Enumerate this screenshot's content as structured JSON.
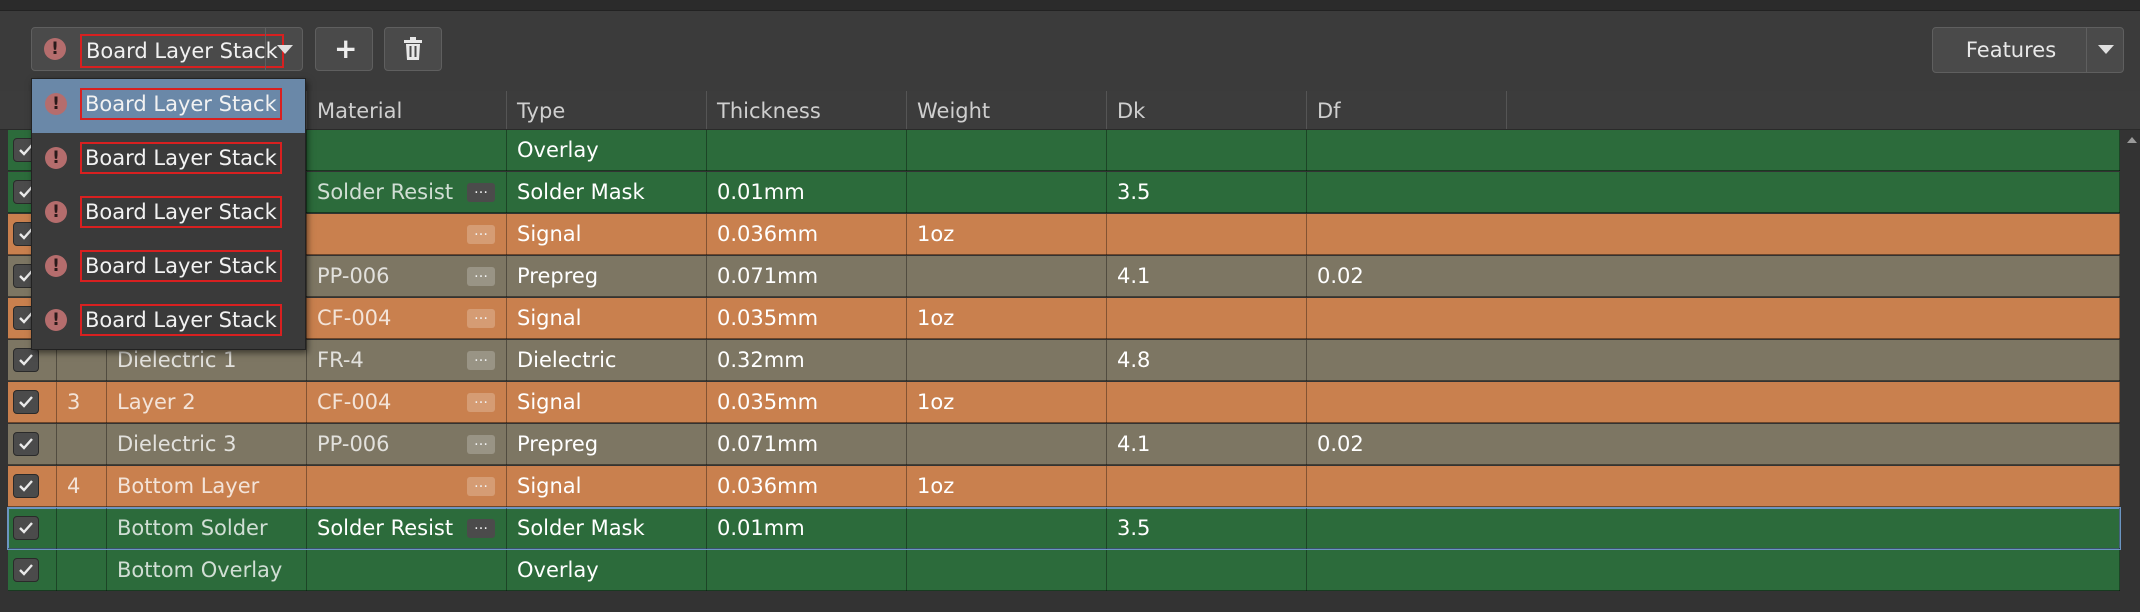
{
  "toolbar": {
    "stack_name": "Board Layer Stack",
    "add_label": "+",
    "features_label": "Features"
  },
  "dropdown": {
    "items": [
      {
        "label": "Board Layer Stack",
        "highlighted": true
      },
      {
        "label": "Board Layer Stack",
        "highlighted": false
      },
      {
        "label": "Board Layer Stack",
        "highlighted": false
      },
      {
        "label": "Board Layer Stack",
        "highlighted": false
      },
      {
        "label": "Board Layer Stack",
        "highlighted": false
      }
    ]
  },
  "table": {
    "headers": {
      "material": "Material",
      "type": "Type",
      "thickness": "Thickness",
      "weight": "Weight",
      "dk": "Dk",
      "df": "Df"
    },
    "rows": [
      {
        "num": "",
        "name": "",
        "material": "",
        "has_more": false,
        "type": "Overlay",
        "thickness": "",
        "weight": "",
        "dk": "",
        "df": "",
        "kind": "overlay"
      },
      {
        "num": "",
        "name": "",
        "material": "Solder Resist",
        "has_more": true,
        "type": "Solder Mask",
        "thickness": "0.01mm",
        "weight": "",
        "dk": "3.5",
        "df": "",
        "kind": "mask"
      },
      {
        "num": "",
        "name": "",
        "material": "",
        "has_more": true,
        "type": "Signal",
        "thickness": "0.036mm",
        "weight": "1oz",
        "dk": "",
        "df": "",
        "kind": "signal"
      },
      {
        "num": "",
        "name": "",
        "material": "PP-006",
        "has_more": true,
        "type": "Prepreg",
        "thickness": "0.071mm",
        "weight": "",
        "dk": "4.1",
        "df": "0.02",
        "kind": "dielectric"
      },
      {
        "num": "",
        "name": "",
        "material": "CF-004",
        "has_more": true,
        "type": "Signal",
        "thickness": "0.035mm",
        "weight": "1oz",
        "dk": "",
        "df": "",
        "kind": "signal"
      },
      {
        "num": "",
        "name": "Dielectric 1",
        "material": "FR-4",
        "has_more": true,
        "type": "Dielectric",
        "thickness": "0.32mm",
        "weight": "",
        "dk": "4.8",
        "df": "",
        "kind": "dielectric"
      },
      {
        "num": "3",
        "name": "Layer 2",
        "material": "CF-004",
        "has_more": true,
        "type": "Signal",
        "thickness": "0.035mm",
        "weight": "1oz",
        "dk": "",
        "df": "",
        "kind": "signal"
      },
      {
        "num": "",
        "name": "Dielectric 3",
        "material": "PP-006",
        "has_more": true,
        "type": "Prepreg",
        "thickness": "0.071mm",
        "weight": "",
        "dk": "4.1",
        "df": "0.02",
        "kind": "dielectric"
      },
      {
        "num": "4",
        "name": "Bottom Layer",
        "material": "",
        "has_more": true,
        "type": "Signal",
        "thickness": "0.036mm",
        "weight": "1oz",
        "dk": "",
        "df": "",
        "kind": "signal"
      },
      {
        "num": "",
        "name": "Bottom Solder",
        "material": "Solder Resist",
        "has_more": true,
        "type": "Solder Mask",
        "thickness": "0.01mm",
        "weight": "",
        "dk": "3.5",
        "df": "",
        "kind": "mask",
        "selected": true
      },
      {
        "num": "",
        "name": "Bottom Overlay",
        "material": "",
        "has_more": false,
        "type": "Overlay",
        "thickness": "",
        "weight": "",
        "dk": "",
        "df": "",
        "kind": "overlay"
      }
    ]
  },
  "colors": {
    "overlay": "#2c6b3b",
    "mask": "#2c6b3b",
    "signal": "#c9804e",
    "dielectric": "#7d7663",
    "selected_border": "#6b95c2",
    "warning": "#b56d6d"
  }
}
